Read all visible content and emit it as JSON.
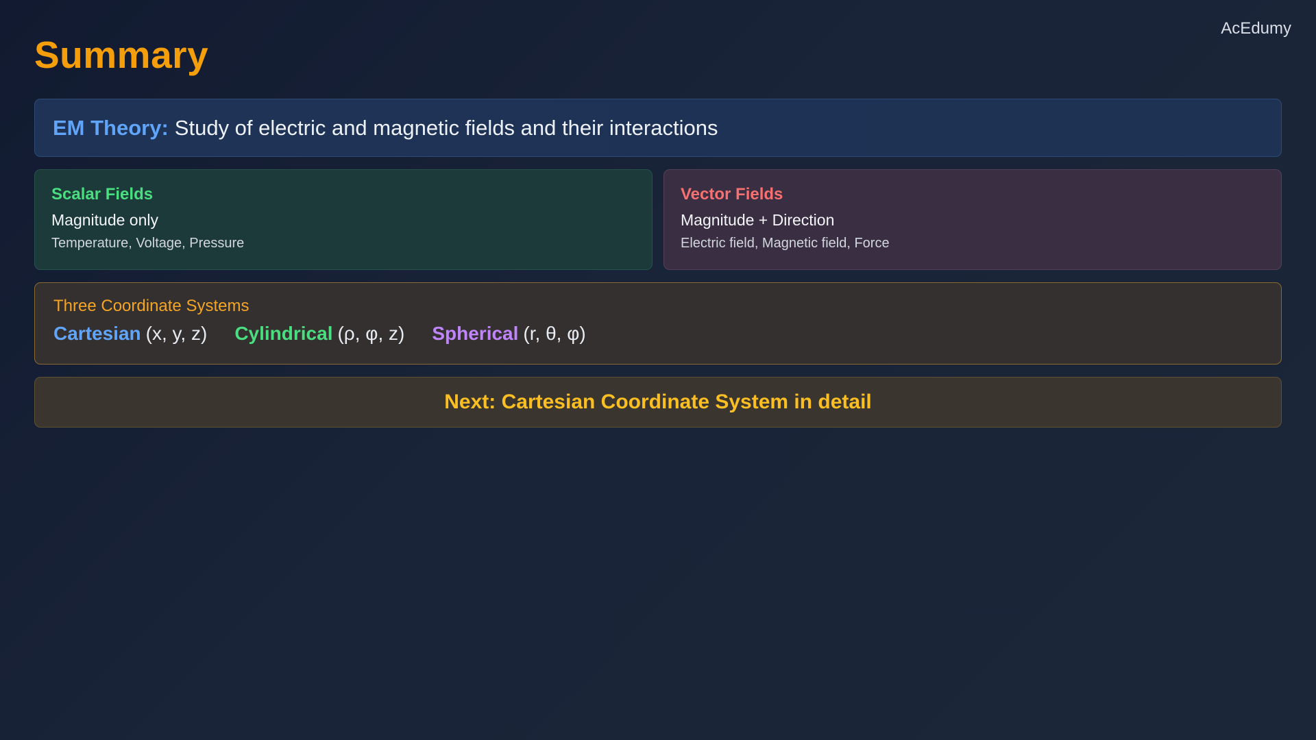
{
  "brand": "AcEdumy",
  "title": "Summary",
  "definition": {
    "term": "EM Theory:",
    "text": "Study of electric and magnetic fields and their interactions"
  },
  "scalar": {
    "title": "Scalar Fields",
    "main": "Magnitude only",
    "examples": "Temperature, Voltage, Pressure"
  },
  "vector": {
    "title": "Vector Fields",
    "main": "Magnitude + Direction",
    "examples": "Electric field, Magnetic field, Force"
  },
  "coordinates": {
    "title": "Three Coordinate Systems",
    "systems": [
      {
        "name": "Cartesian",
        "vars": "(x, y, z)"
      },
      {
        "name": "Cylindrical",
        "vars": "(ρ, φ, z)"
      },
      {
        "name": "Spherical",
        "vars": "(r, θ, φ)"
      }
    ]
  },
  "next": "Next: Cartesian Coordinate System in detail",
  "colors": {
    "title": "#f59e0b",
    "em_term": "#60a5fa",
    "scalar": "#4ade80",
    "vector": "#f87171",
    "cartesian": "#60a5fa",
    "cylindrical": "#4ade80",
    "spherical": "#c084fc",
    "next": "#fbbf24"
  }
}
